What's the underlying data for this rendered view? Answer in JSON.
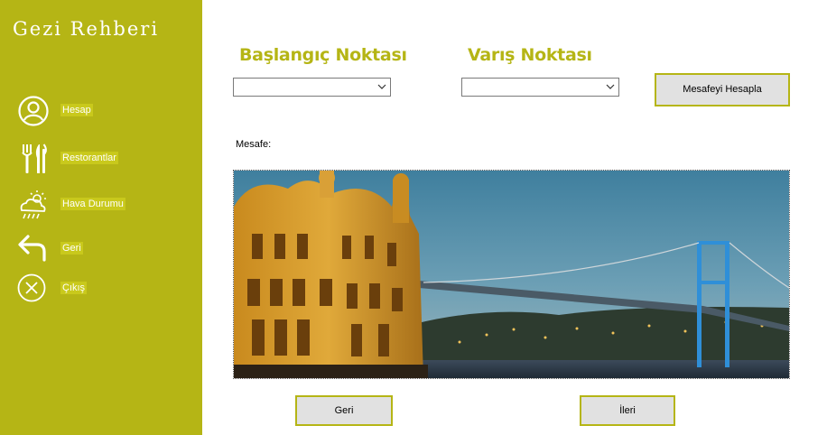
{
  "sidebar": {
    "title": "Gezi Rehberi",
    "items": [
      {
        "label": "Hesap",
        "icon": "account-icon"
      },
      {
        "label": "Restorantlar",
        "icon": "fork-knife-icon"
      },
      {
        "label": "Hava Durumu",
        "icon": "weather-icon"
      },
      {
        "label": "Geri",
        "icon": "back-arrow-icon"
      },
      {
        "label": "Çıkış",
        "icon": "close-circle-icon"
      }
    ]
  },
  "main": {
    "start_heading": "Başlangıç Noktası",
    "end_heading": "Varış Noktası",
    "start_select_value": "",
    "end_select_value": "",
    "calculate_button": "Mesafeyi Hesapla",
    "distance_label": "Mesafe:",
    "back_button": "Geri",
    "next_button": "İleri",
    "image_subject": "istanbul-ortakoy-mosque-bosphorus-bridge-image"
  },
  "colors": {
    "accent": "#b5b515",
    "button_bg": "#e1e1e1"
  }
}
